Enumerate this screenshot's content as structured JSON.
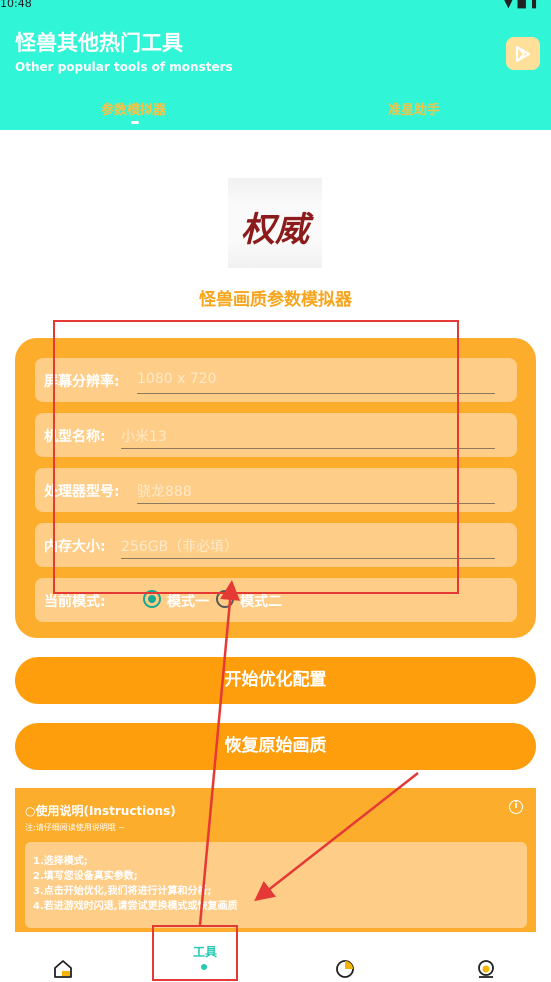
{
  "status": {
    "time": "10:48",
    "icons": "▼■▮"
  },
  "header": {
    "title": "怪兽其他热门工具",
    "subtitle": "Other popular tools of monsters"
  },
  "tabs": [
    {
      "label": "参数模拟器",
      "active": true
    },
    {
      "label": "准星助手",
      "active": false
    }
  ],
  "logo": {
    "text": "权威"
  },
  "simulator": {
    "title": "怪兽画质参数模拟器",
    "fields": [
      {
        "label": "屏幕分辨率:",
        "placeholder": "1080 x 720"
      },
      {
        "label": "机型名称:",
        "placeholder": "小米13"
      },
      {
        "label": "处理器型号:",
        "placeholder": "骁龙888"
      },
      {
        "label": "内存大小:",
        "placeholder": "256GB（非必填）"
      }
    ],
    "mode": {
      "label": "当前模式:",
      "options": [
        "模式一",
        "模式二"
      ],
      "selected": "模式一"
    }
  },
  "buttons": {
    "start": "开始优化配置",
    "restore": "恢复原始画质"
  },
  "instructions": {
    "title": "使用说明(Instructions)",
    "note": "注:请仔细阅读使用说明哦 ~",
    "items": [
      "1.选择模式;",
      "2.填写您设备真实参数;",
      "3.点击开始优化,我们将进行计算和分析;",
      "4.若进游戏时闪退,请尝试更换模式或恢复画质"
    ]
  },
  "bottom_nav": {
    "items": [
      {
        "name": "home",
        "icon": "home-icon"
      },
      {
        "name": "tools",
        "label": "工具",
        "active": true
      },
      {
        "name": "stats",
        "icon": "chart-icon"
      },
      {
        "name": "profile",
        "icon": "user-icon"
      }
    ]
  },
  "colors": {
    "header": "#30f5d6",
    "accent": "#fdad2c",
    "button": "#ff9e0d",
    "annotation": "#e53935",
    "active_nav": "#23c9b2"
  }
}
